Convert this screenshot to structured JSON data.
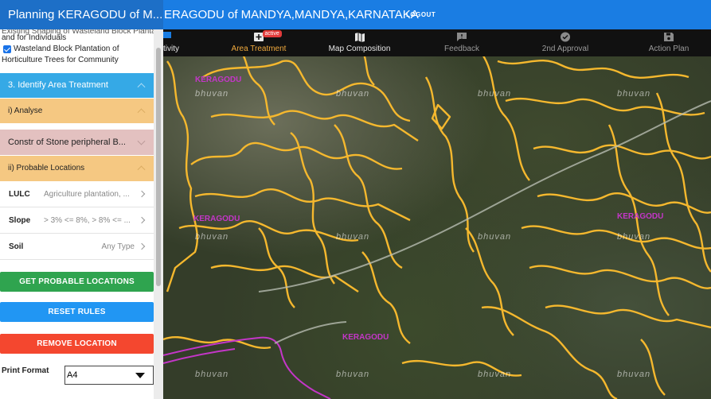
{
  "header": {
    "panel_title": "Planning KERAGODU of M...",
    "location_title": "ERAGODU of MANDYA,MANDYA,KARNATAKA",
    "logout_label": "LOGOUT"
  },
  "tabs": [
    {
      "label": "tivity",
      "icon": "activity-icon"
    },
    {
      "label": "Area Treatment",
      "icon": "add-box-icon",
      "badge": "active"
    },
    {
      "label": "Map Composition",
      "icon": "map-icon"
    },
    {
      "label": "Feedback",
      "icon": "feedback-icon"
    },
    {
      "label": "2nd Approval",
      "icon": "check-circle-icon"
    },
    {
      "label": "Action Plan",
      "icon": "save-icon"
    }
  ],
  "sidebar": {
    "cut_line_top": "Existing Shaping of Wasteland Block Plantation",
    "cut_line_1": "and for Individuals",
    "checkbox_label_1": "Wasteland Block Plantation of",
    "checkbox_label_2": "Horticulture Trees for Community",
    "step_header": "3. Identify Area Treatment",
    "analyse": "i) Analyse",
    "treatment": "Constr of Stone peripheral B...",
    "probable_locations": "ii) Probable Locations",
    "rules": [
      {
        "name": "LULC",
        "value": "Agriculture plantation, ..."
      },
      {
        "name": "Slope",
        "value": "> 3% <= 8%, > 8% <= ..."
      },
      {
        "name": "Soil",
        "value": "Any Type"
      }
    ],
    "buttons": {
      "get_probable": "GET PROBABLE LOCATIONS",
      "reset": "RESET RULES",
      "remove": "REMOVE LOCATION"
    },
    "print_format_label": "Print Format",
    "print_format_value": "A4"
  },
  "map": {
    "watermark": "bhuvan",
    "place_label": "KERAGODU"
  },
  "colors": {
    "header_blue": "#1a7de3",
    "panel_blue": "#1d6fc7",
    "step_blue": "#35a9e6",
    "analyse_orange": "#f5c882",
    "treatment_pink": "#e3c1c0",
    "active_tab": "#f0a93d",
    "green_button": "#2fa44f",
    "blue_button": "#2196f3",
    "red_button": "#f4472f",
    "boundary_yellow": "#f5b82e",
    "road_magenta": "#c436c8"
  }
}
